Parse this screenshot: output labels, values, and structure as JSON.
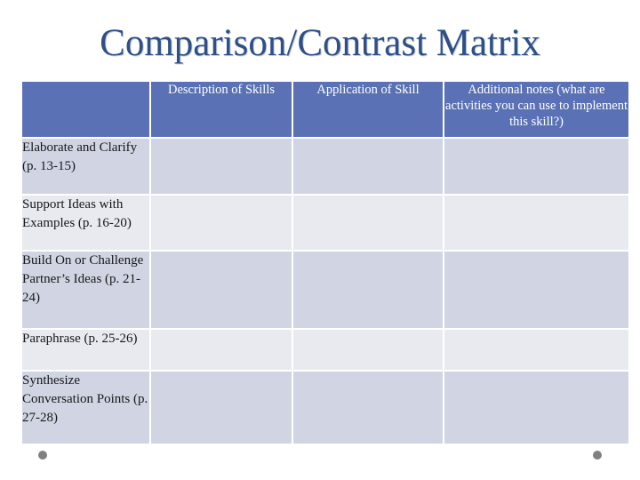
{
  "slide": {
    "title": "Comparison/Contrast Matrix",
    "title_color": "#2f4f87",
    "background_color": "#ffffff"
  },
  "table": {
    "header_background": "#5a72b5",
    "header_text_color": "#ffffff",
    "band_dark_color": "#d1d5e3",
    "band_light_color": "#e8eaf0",
    "columns": [
      {
        "key": "skill",
        "label": ""
      },
      {
        "key": "description",
        "label": "Description of Skills"
      },
      {
        "key": "application",
        "label": "Application of Skill"
      },
      {
        "key": "notes",
        "label": "Additional notes (what are activities you can use to implement this skill?)"
      }
    ],
    "rows": [
      {
        "skill": "Elaborate and Clarify (p. 13-15)",
        "description": "",
        "application": "",
        "notes": "",
        "band": "dark"
      },
      {
        "skill": "Support Ideas with Examples (p. 16-20)",
        "description": "",
        "application": "",
        "notes": "",
        "band": "light"
      },
      {
        "skill": "Build On or Challenge Partner’s Ideas (p. 21-24)",
        "description": "",
        "application": "",
        "notes": "",
        "band": "dark"
      },
      {
        "skill": "Paraphrase (p. 25-26)",
        "description": "",
        "application": "",
        "notes": "",
        "band": "light"
      },
      {
        "skill": "Synthesize Conversation Points (p. 27-28)",
        "description": "",
        "application": "",
        "notes": "",
        "band": "dark"
      }
    ]
  },
  "decorations": {
    "dot_color": "#808080",
    "dot_left_name": "bullet-dot-left",
    "dot_right_name": "bullet-dot-right"
  }
}
